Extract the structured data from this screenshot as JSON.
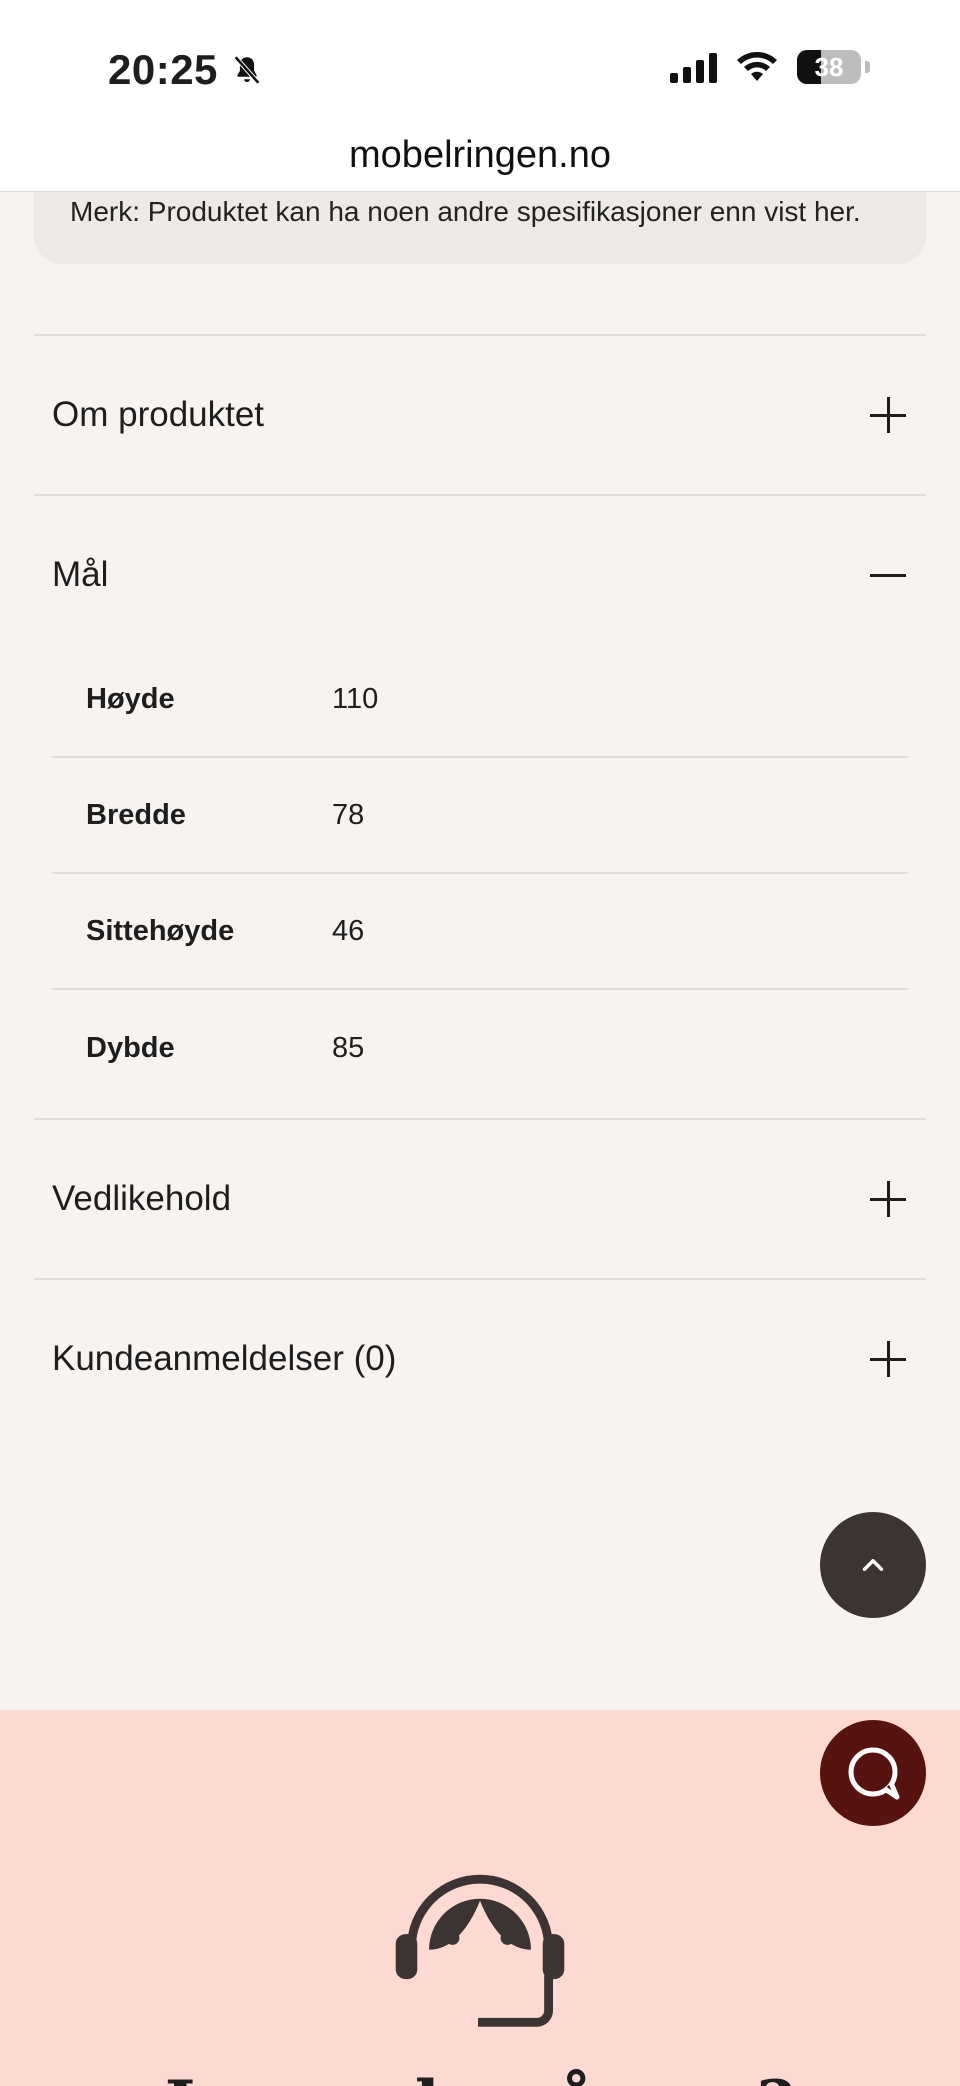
{
  "status_bar": {
    "time": "20:25",
    "battery": "38",
    "icons": [
      "bell-slash-icon",
      "signal-icon",
      "wifi-icon",
      "battery-icon"
    ]
  },
  "browser": {
    "url": "mobelringen.no"
  },
  "note": {
    "text": "Merk: Produktet kan ha noen andre spesifikasjoner enn vist her."
  },
  "accordion": {
    "items": [
      {
        "title": "Om produktet",
        "state": "collapsed"
      },
      {
        "title": "Mål",
        "state": "expanded"
      },
      {
        "title": "Vedlikehold",
        "state": "collapsed"
      },
      {
        "title": "Kundeanmeldelser (0)",
        "state": "collapsed"
      }
    ],
    "dimensions": [
      {
        "label": "Høyde",
        "value": "110"
      },
      {
        "label": "Bredde",
        "value": "78"
      },
      {
        "label": "Sittehøyde",
        "value": "46"
      },
      {
        "label": "Dybde",
        "value": "85"
      }
    ]
  },
  "help": {
    "title": "Lurer du på noe?"
  },
  "colors": {
    "page_bg": "#f6f3f0",
    "help_bg": "#fcd9d1",
    "scroll_top_btn": "#3b3432",
    "chat_btn": "#56130f"
  }
}
